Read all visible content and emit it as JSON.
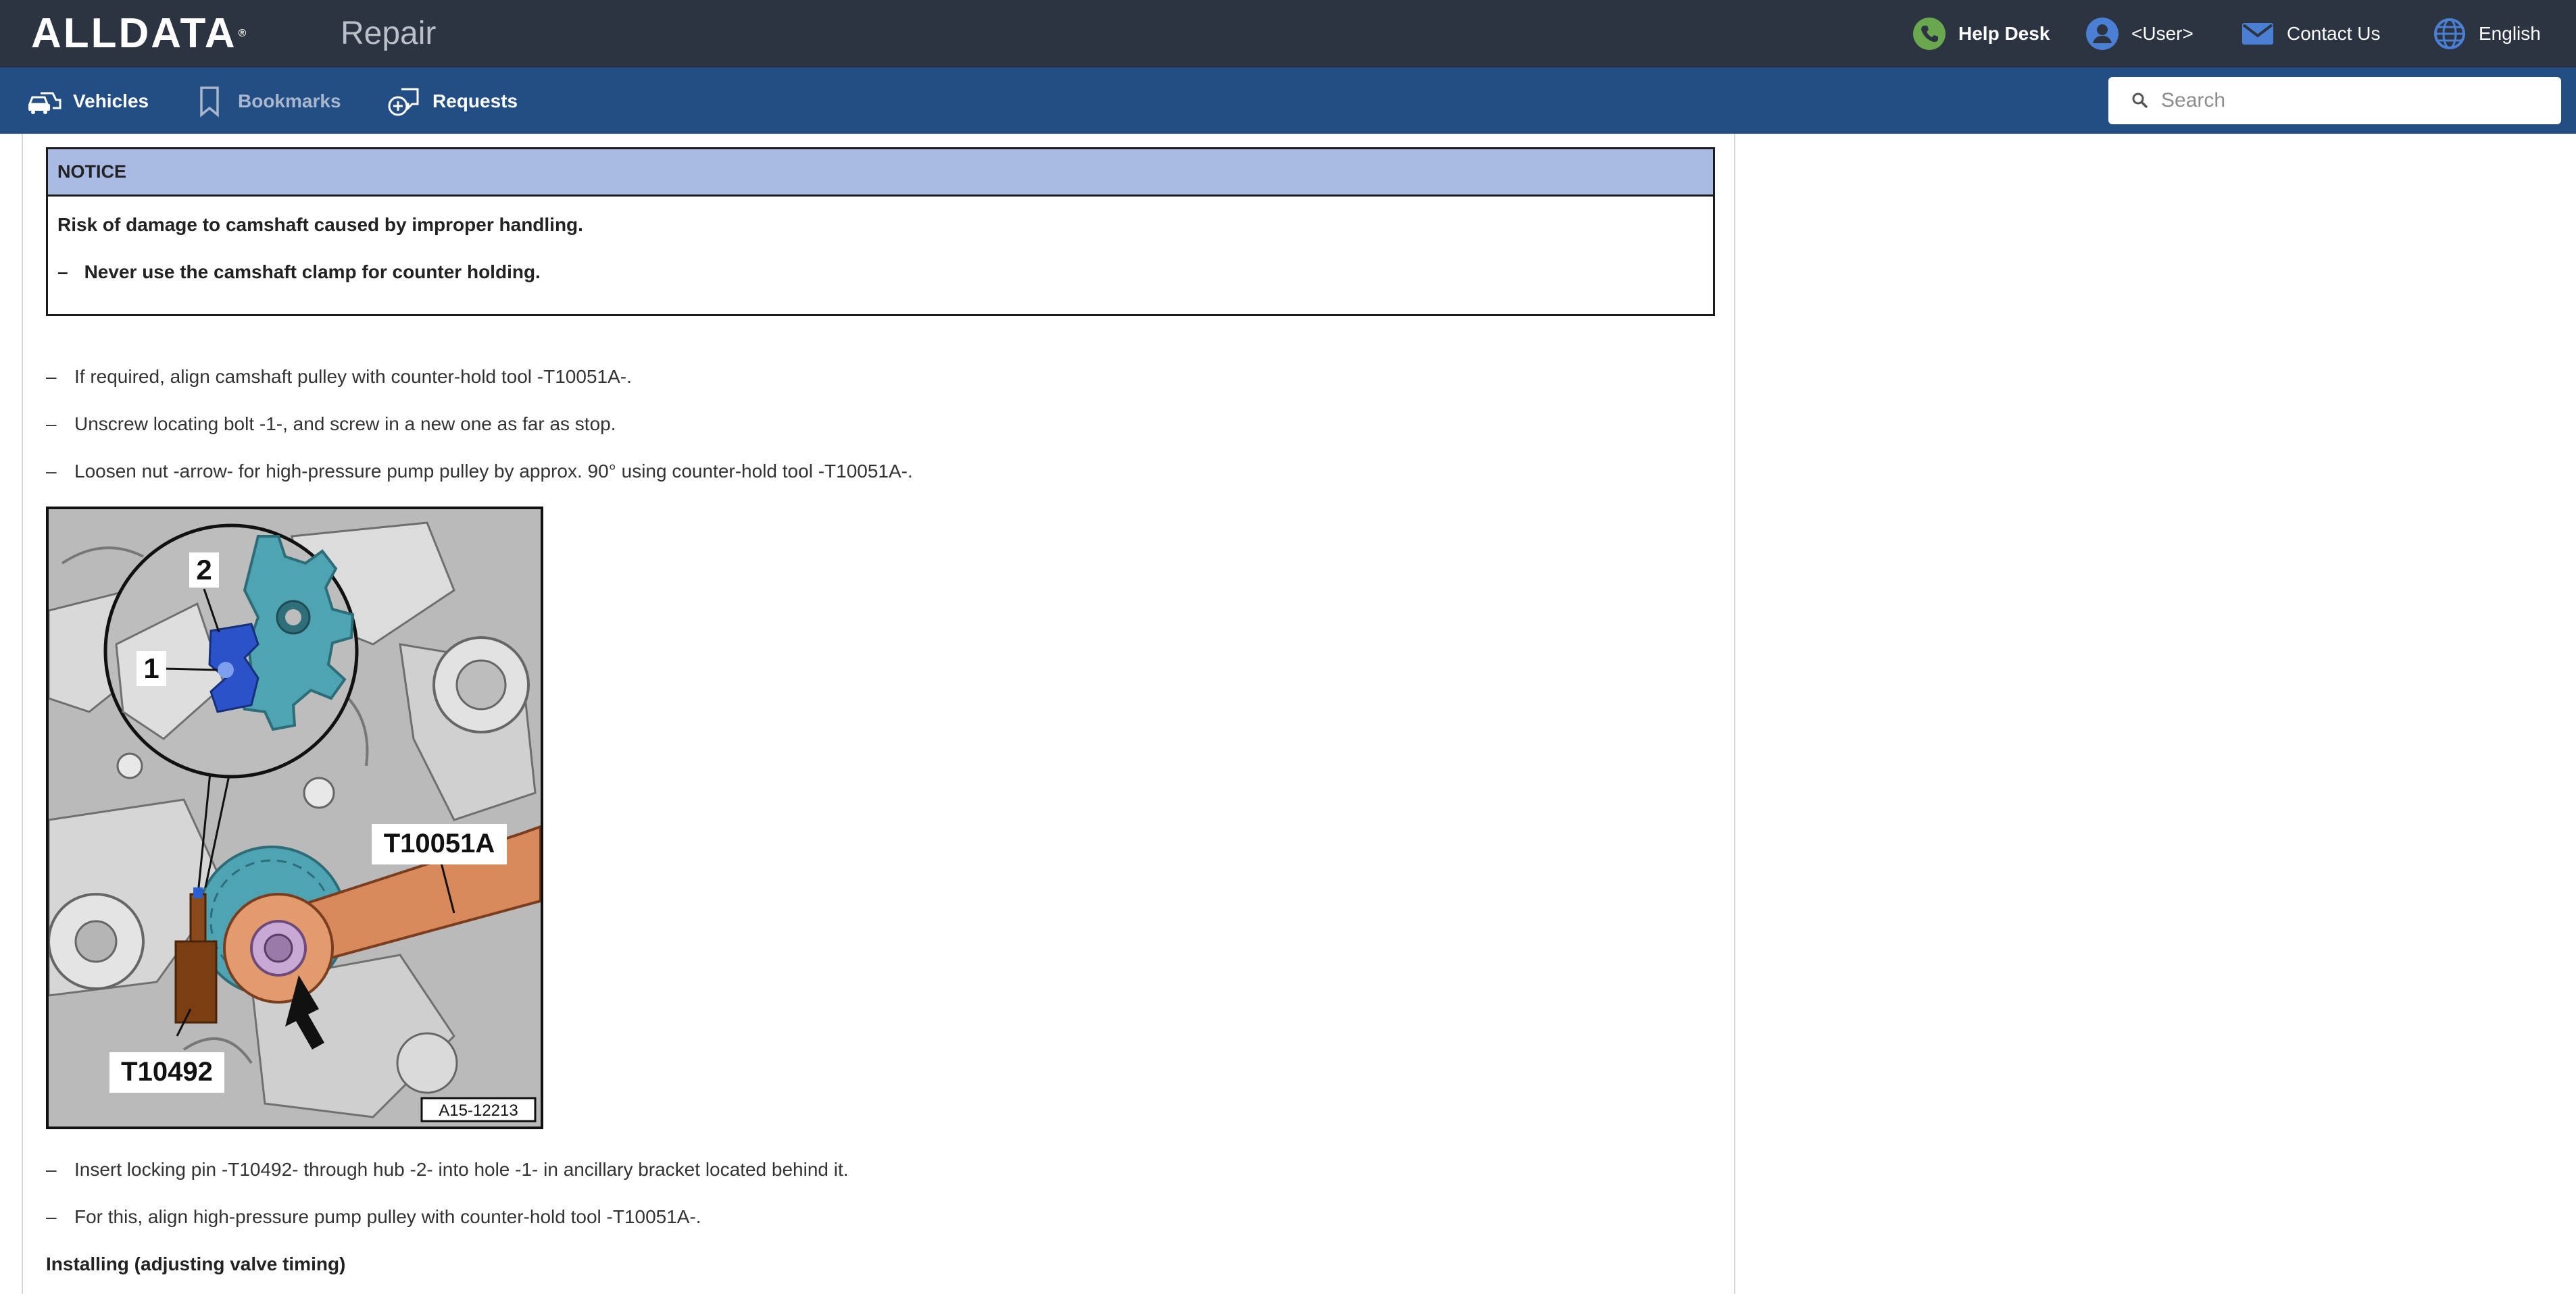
{
  "header": {
    "logo": "ALLDATA",
    "logo_mark": "®",
    "app_name": "Repair",
    "help_desk": "Help Desk",
    "user": "<User>",
    "contact_us": "Contact Us",
    "language": "English"
  },
  "nav": {
    "vehicles": "Vehicles",
    "bookmarks": "Bookmarks",
    "requests": "Requests"
  },
  "search": {
    "placeholder": "Search"
  },
  "notice": {
    "title": "NOTICE",
    "line1": "Risk of damage to camshaft caused by improper handling.",
    "line2_dash": "–",
    "line2": "Never use the camshaft clamp for counter holding."
  },
  "steps": {
    "s1": "If required, align camshaft pulley with counter-hold tool -T10051A-.",
    "s2": "Unscrew locating bolt -1-, and screw in a new one as far as stop.",
    "s3": "Loosen nut -arrow- for high-pressure pump pulley by approx. 90° using counter-hold tool -T10051A-.",
    "s4": "Insert locking pin -T10492- through hub -2- into hole -1- in ancillary bracket located behind it.",
    "s5": "For this, align high-pressure pump pulley with counter-hold tool -T10051A-.",
    "dash": "–"
  },
  "figure": {
    "label_1": "1",
    "label_2": "2",
    "label_tool_a": "T10051A",
    "label_tool_b": "T10492",
    "figure_id": "A15-12213"
  },
  "section_heading": "Installing (adjusting valve timing)",
  "colors": {
    "topbar": "#2b3440",
    "navbar": "#234d85",
    "notice_header": "#a8b9e3",
    "helpdesk_icon": "#6aa84f",
    "user_icon": "#4a7fd4"
  },
  "icons": {
    "help_desk": "phone-icon",
    "user": "user-circle-icon",
    "contact": "mail-icon",
    "language": "globe-icon",
    "vehicles": "vehicles-icon",
    "bookmarks": "bookmark-icon",
    "requests": "requests-icon",
    "search": "search-icon"
  }
}
